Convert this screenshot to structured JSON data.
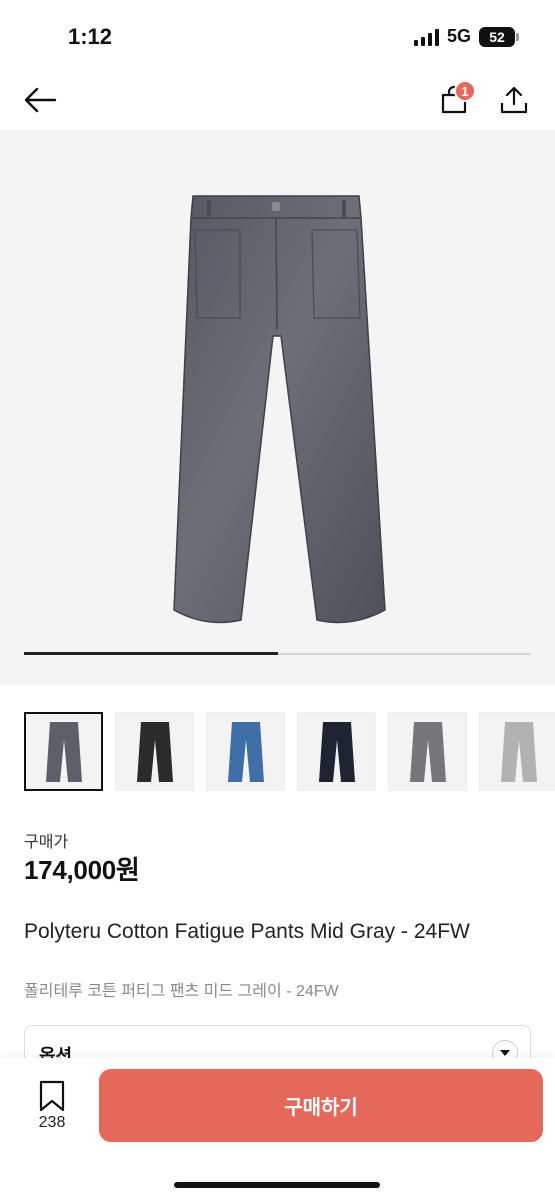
{
  "status_bar": {
    "time": "1:12",
    "network": "5G",
    "battery": "52"
  },
  "header": {
    "cart_badge": "1"
  },
  "gallery": {
    "progress_fraction": 0.5
  },
  "thumbnails": [
    {
      "name": "thumb-mid-gray",
      "color": "#5d6068"
    },
    {
      "name": "thumb-black",
      "color": "#2b2b2d"
    },
    {
      "name": "thumb-blue",
      "color": "#3f6ea8"
    },
    {
      "name": "thumb-navy",
      "color": "#1f2433"
    },
    {
      "name": "thumb-gray",
      "color": "#75757c"
    },
    {
      "name": "thumb-light-gray",
      "color": "#b2b3b1"
    }
  ],
  "price": {
    "label": "구매가",
    "value": "174,000원"
  },
  "product": {
    "title_en": "Polyteru Cotton Fatigue Pants Mid Gray - 24FW",
    "title_ko": "폴리테루 코튼 퍼티그 팬츠 미드 그레이 - 24FW"
  },
  "option": {
    "label": "옵션"
  },
  "bottom_bar": {
    "save_count": "238",
    "buy_label": "구매하기"
  },
  "colors": {
    "accent": "#e4695a",
    "pants": "#5f626a"
  }
}
